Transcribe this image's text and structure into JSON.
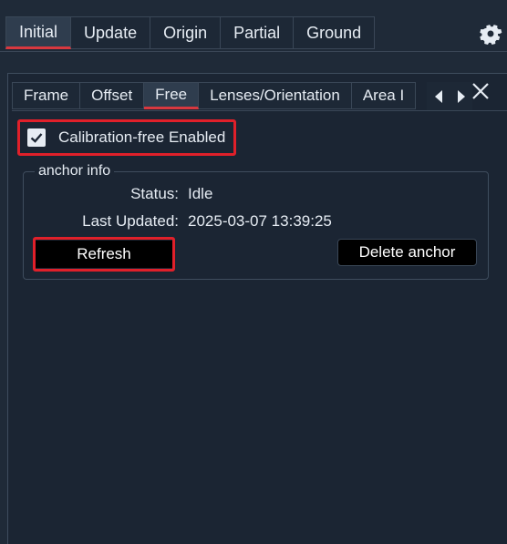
{
  "top_tabs": [
    {
      "label": "Initial",
      "active": true
    },
    {
      "label": "Update"
    },
    {
      "label": "Origin"
    },
    {
      "label": "Partial"
    },
    {
      "label": "Ground"
    }
  ],
  "sub_tabs": [
    {
      "label": "Frame"
    },
    {
      "label": "Offset"
    },
    {
      "label": "Free",
      "active": true
    },
    {
      "label": "Lenses/Orientation"
    },
    {
      "label": "Area I"
    }
  ],
  "calibration": {
    "label": "Calibration-free Enabled",
    "checked": true
  },
  "anchor_info": {
    "legend": "anchor info",
    "status_label": "Status:",
    "status_value": "Idle",
    "updated_label": "Last Updated:",
    "updated_value": "2025-03-07 13:39:25",
    "refresh_label": "Refresh",
    "delete_label": "Delete anchor"
  },
  "colors": {
    "background": "#1f2a38",
    "panel": "#1b2533",
    "accent_red": "#d8383f",
    "highlight_red": "#e0202a"
  },
  "icons": {
    "settings": "gear-icon",
    "close": "close-icon",
    "scroll_left": "triangle-left-icon",
    "scroll_right": "triangle-right-icon",
    "check": "checkmark-icon"
  }
}
